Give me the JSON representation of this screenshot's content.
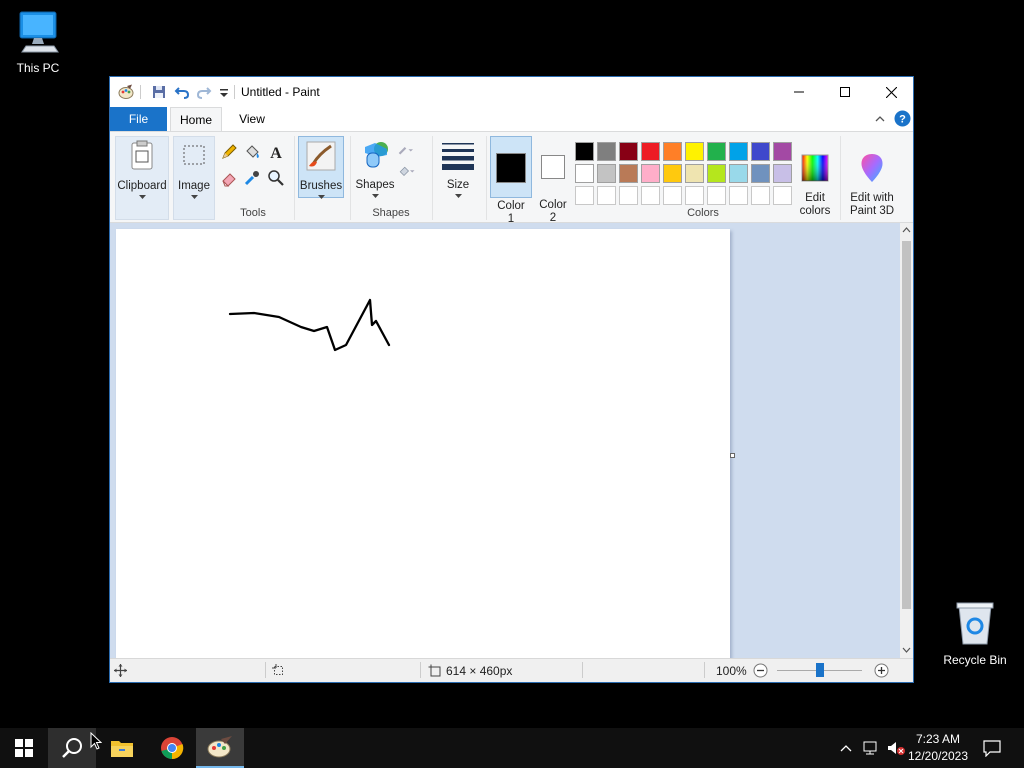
{
  "desktop": {
    "this_pc_label": "This PC",
    "recycle_bin_label": "Recycle Bin"
  },
  "window": {
    "title": "Untitled - Paint",
    "tabs": [
      {
        "label": "File"
      },
      {
        "label": "Home"
      },
      {
        "label": "View"
      }
    ]
  },
  "ribbon": {
    "clipboard_label": "Clipboard",
    "image_label": "Image",
    "tools_group_label": "Tools",
    "brushes_label": "Brushes",
    "shapes_label": "Shapes",
    "shapes_group_label": "Shapes",
    "size_label": "Size",
    "color1_label": "Color\n1",
    "color2_label": "Color\n2",
    "colors_group_label": "Colors",
    "edit_colors_label": "Edit\ncolors",
    "edit_3d_label": "Edit with\nPaint 3D",
    "color1_value": "#000000",
    "color2_value": "#ffffff",
    "palette_row1": [
      "#000000",
      "#7f7f7f",
      "#880015",
      "#ed1c24",
      "#ff7f27",
      "#fff200",
      "#22b14c",
      "#00a2e8",
      "#3f48cc",
      "#a349a4"
    ],
    "palette_row2": [
      "#ffffff",
      "#c3c3c3",
      "#b97a57",
      "#ffaec9",
      "#ffc90e",
      "#efe4b0",
      "#b5e61d",
      "#99d9ea",
      "#7092be",
      "#c8bfe7"
    ],
    "palette_row3_count": 10
  },
  "status": {
    "canvas_size": "614 × 460px",
    "zoom": "100%",
    "zoom_level_percent": 100
  },
  "taskbar": {
    "time": "7:23 AM",
    "date": "12/20/2023",
    "apps": [
      "start-icon",
      "search-icon",
      "file-explorer-icon",
      "chrome-icon",
      "paint-icon"
    ]
  },
  "colors": {
    "accent": "#1a73c9",
    "workspace_bg": "#cfdcee",
    "selected_button": "#cde4f7"
  }
}
